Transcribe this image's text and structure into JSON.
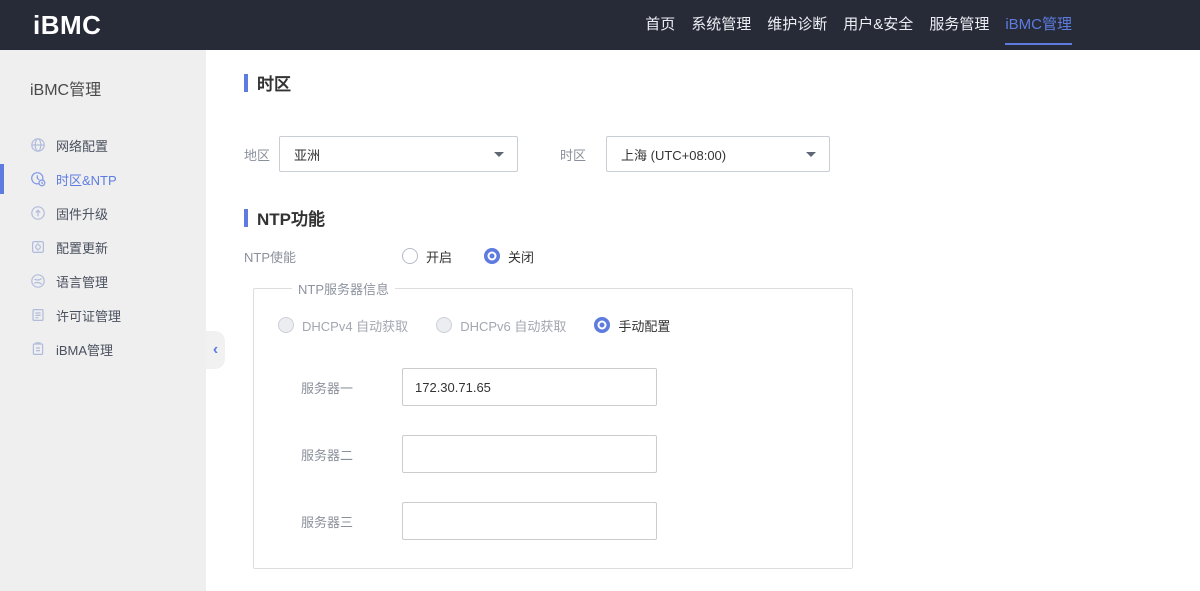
{
  "header": {
    "logo": "iBMC",
    "nav": [
      {
        "label": "首页",
        "active": false
      },
      {
        "label": "系统管理",
        "active": false
      },
      {
        "label": "维护诊断",
        "active": false
      },
      {
        "label": "用户&安全",
        "active": false
      },
      {
        "label": "服务管理",
        "active": false
      },
      {
        "label": "iBMC管理",
        "active": true
      }
    ]
  },
  "sidebar": {
    "title": "iBMC管理",
    "items": [
      {
        "label": "网络配置",
        "icon": "globe-icon",
        "active": false
      },
      {
        "label": "时区&NTP",
        "icon": "clock-icon",
        "active": true
      },
      {
        "label": "固件升级",
        "icon": "upgrade-icon",
        "active": false
      },
      {
        "label": "配置更新",
        "icon": "config-update-icon",
        "active": false
      },
      {
        "label": "语言管理",
        "icon": "language-icon",
        "active": false
      },
      {
        "label": "许可证管理",
        "icon": "license-icon",
        "active": false
      },
      {
        "label": "iBMA管理",
        "icon": "clipboard-icon",
        "active": false
      }
    ],
    "collapse_icon": "‹"
  },
  "main": {
    "timezone_section": {
      "title": "时区",
      "region_label": "地区",
      "region_value": "亚洲",
      "timezone_label": "时区",
      "timezone_value": "上海 (UTC+08:00)"
    },
    "ntp_section": {
      "title": "NTP功能",
      "enable_label": "NTP使能",
      "enable_on_label": "开启",
      "enable_off_label": "关闭",
      "server_group": {
        "legend": "NTP服务器信息",
        "mode_dhcpv4_label": "DHCPv4 自动获取",
        "mode_dhcpv6_label": "DHCPv6 自动获取",
        "mode_manual_label": "手动配置",
        "servers": [
          {
            "label": "服务器一",
            "value": "172.30.71.65"
          },
          {
            "label": "服务器二",
            "value": ""
          },
          {
            "label": "服务器三",
            "value": ""
          }
        ]
      }
    }
  },
  "colors": {
    "accent": "#5e7ce0",
    "header_bg": "#272b37",
    "sidebar_bg": "#efefef"
  }
}
